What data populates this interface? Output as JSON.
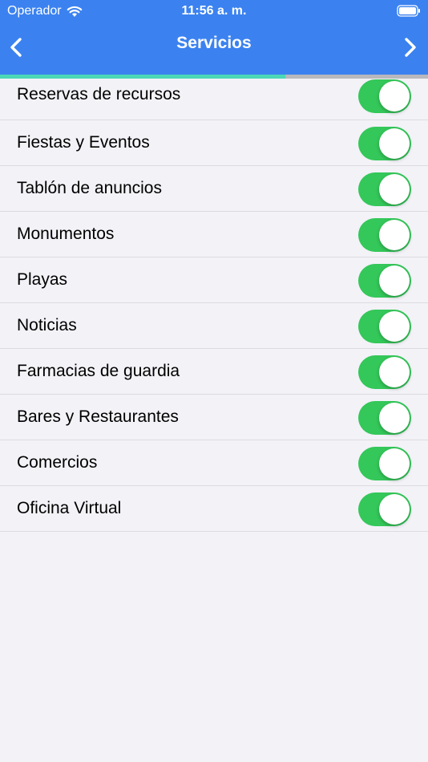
{
  "status_bar": {
    "carrier": "Operador",
    "time": "11:56 a. m.",
    "wifi_icon": "wifi-icon",
    "battery_icon": "battery-icon"
  },
  "nav": {
    "title": "Servicios",
    "back_icon": "chevron-left-icon",
    "forward_icon": "chevron-right-icon"
  },
  "progress": {
    "fraction": 0.667,
    "color": "#4cd7b6"
  },
  "colors": {
    "header": "#3b82f0",
    "toggle_on": "#34c759",
    "background": "#f2f2f7"
  },
  "services": [
    {
      "label": "Reservas de recursos",
      "enabled": true
    },
    {
      "label": "Fiestas y Eventos",
      "enabled": true
    },
    {
      "label": "Tablón de anuncios",
      "enabled": true
    },
    {
      "label": "Monumentos",
      "enabled": true
    },
    {
      "label": "Playas",
      "enabled": true
    },
    {
      "label": "Noticias",
      "enabled": true
    },
    {
      "label": "Farmacias de guardia",
      "enabled": true
    },
    {
      "label": "Bares y Restaurantes",
      "enabled": true
    },
    {
      "label": "Comercios",
      "enabled": true
    },
    {
      "label": "Oficina Virtual",
      "enabled": true
    }
  ]
}
